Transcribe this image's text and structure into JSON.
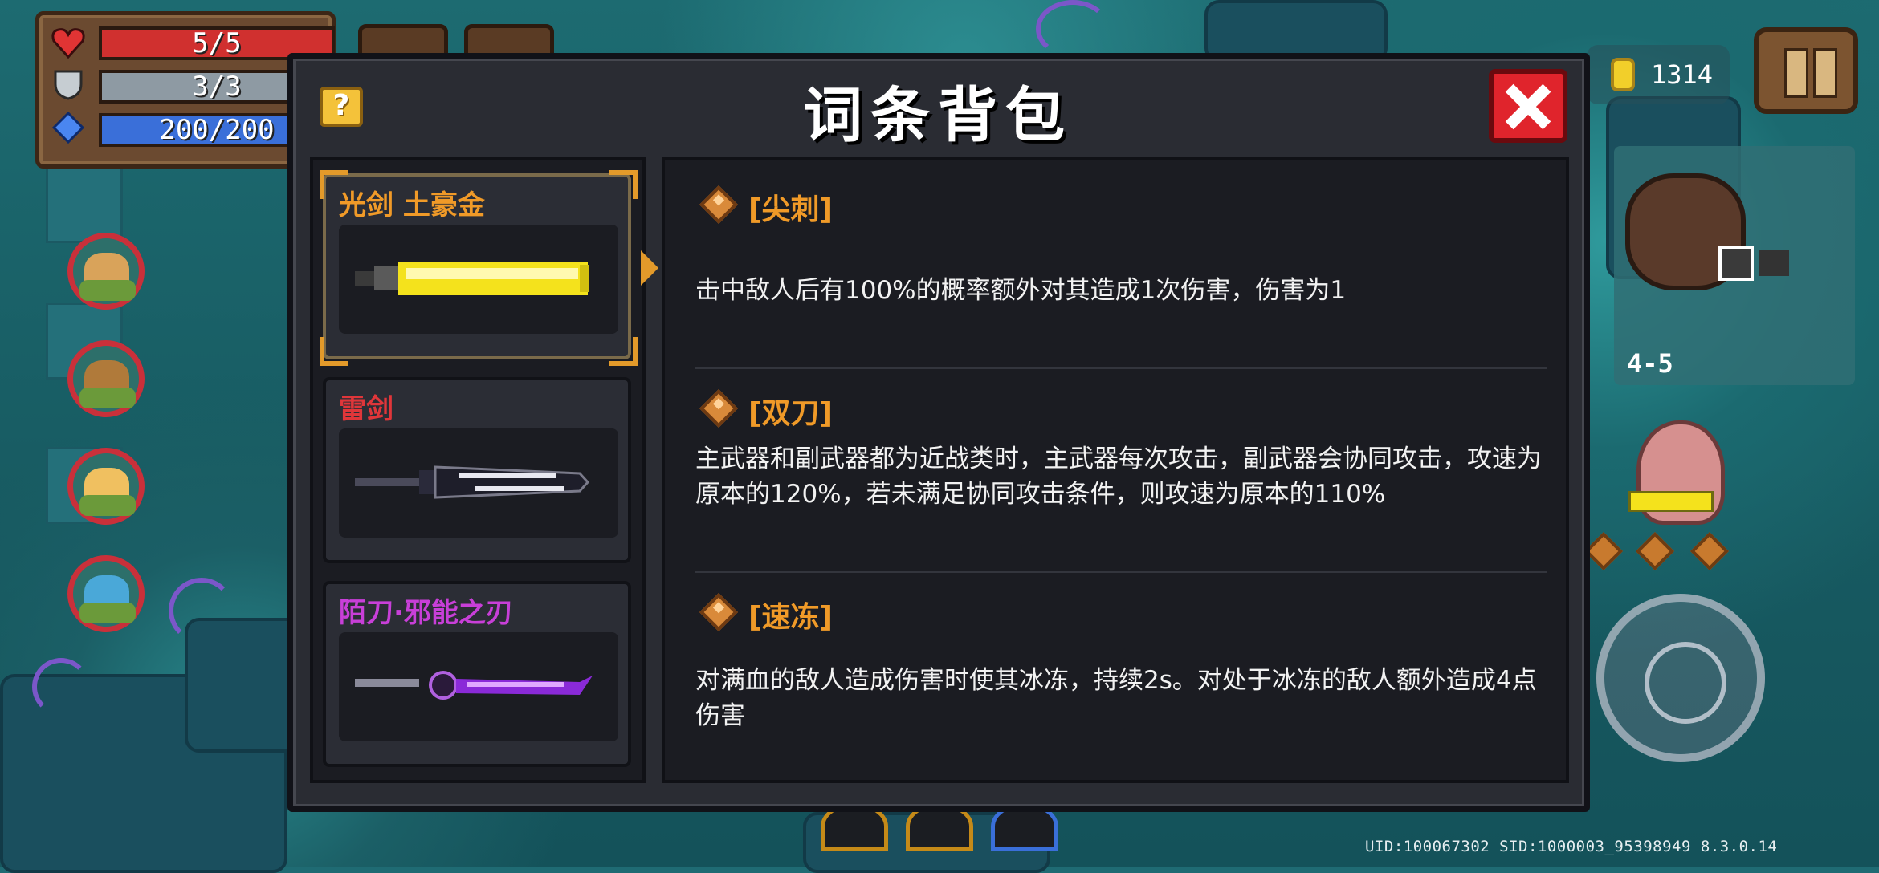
{
  "hud": {
    "hp": "5/5",
    "armor": "3/3",
    "energy": "200/200"
  },
  "top_right": {
    "coins": "1314",
    "level": "4-5"
  },
  "dialog": {
    "title": "词条背包",
    "help_label": "?",
    "weapons": [
      {
        "name": "光剑 土豪金",
        "color": "#f09a28",
        "selected": true
      },
      {
        "name": "雷剑",
        "color": "#e0363a",
        "selected": false
      },
      {
        "name": "陌刀·邪能之刃",
        "color": "#c83fd8",
        "selected": false
      }
    ],
    "entries": [
      {
        "title": "[尖刺]",
        "desc": "击中敌人后有100%的概率额外对其造成1次伤害，伤害为1"
      },
      {
        "title": "[双刀]",
        "desc": "主武器和副武器都为近战类时，主武器每次攻击，副武器会协同攻击，攻速为原本的120%，若未满足协同攻击条件，则攻速为原本的110%"
      },
      {
        "title": "[速冻]",
        "desc": "对满血的敌人造成伤害时使其冰冻，持续2s。对处于冰冻的敌人额外造成4点伤害"
      }
    ]
  },
  "footer": {
    "uid_text": "UID:100067302 SID:1000003_95398949 8.3.0.14"
  },
  "colors": {
    "accent_orange": "#f09a28",
    "close_red": "#e0242c",
    "panel_bg": "#2a2c33"
  },
  "icons": [
    "heart-icon",
    "shield-icon",
    "energy-gem-icon",
    "coin-icon",
    "pause-icon",
    "close-icon",
    "help-icon",
    "entry-gem-icon"
  ]
}
